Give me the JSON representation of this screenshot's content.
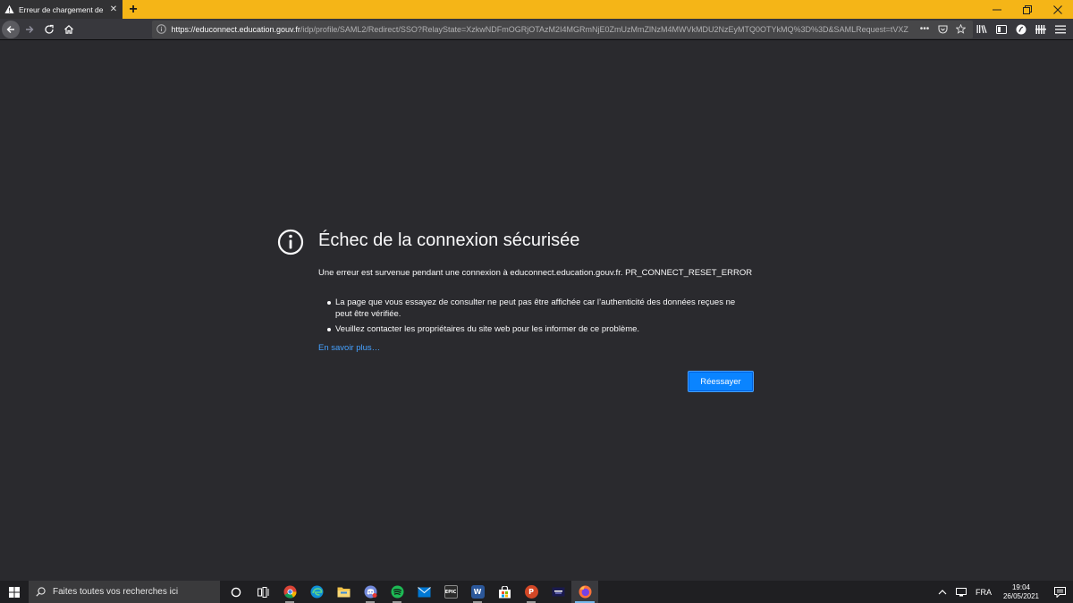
{
  "browser": {
    "tab_title": "Erreur de chargement de la page",
    "url_host": "https://educonnect.education.gouv.fr",
    "url_path": "/idp/profile/SAML2/Redirect/SSO?RelayState=XzkwNDFmOGRjOTAzM2I4MGRmNjE0ZmUzMmZlNzM4MWVkMDU2NzEyMTQ0OTYkMQ%3D%3D&SAMLRequest=tVXZ",
    "page_actions": "•••"
  },
  "error_page": {
    "title": "Échec de la connexion sécurisée",
    "description": "Une erreur est survenue pendant une connexion à educonnect.education.gouv.fr. PR_CONNECT_RESET_ERROR",
    "bullets": [
      "La page que vous essayez de consulter ne peut pas être affichée car l’authenticité des données reçues ne peut être vérifiée.",
      "Veuillez contacter les propriétaires du site web pour les informer de ce problème."
    ],
    "learn_more": "En savoir plus…",
    "retry_label": "Réessayer"
  },
  "taskbar": {
    "search_placeholder": "Faites toutes vos recherches ici",
    "apps": [
      {
        "name": "chrome-icon",
        "label": "",
        "color": "#db4437"
      },
      {
        "name": "edge-icon",
        "label": "",
        "color": "#0f8fd6"
      },
      {
        "name": "file-explorer-icon",
        "label": "",
        "color": "#f2c34a"
      },
      {
        "name": "discord-icon",
        "label": "",
        "color": "#7289da"
      },
      {
        "name": "spotify-icon",
        "label": "",
        "color": "#1db954"
      },
      {
        "name": "mail-icon",
        "label": "",
        "color": "#0078d4"
      },
      {
        "name": "epic-games-icon",
        "label": "EPIC",
        "color": "#2b2b2b"
      },
      {
        "name": "word-icon",
        "label": "W",
        "color": "#2b579a"
      },
      {
        "name": "store-icon",
        "label": "",
        "color": "#ffffff"
      },
      {
        "name": "powerpoint-icon",
        "label": "P",
        "color": "#d24726"
      },
      {
        "name": "app-icon",
        "label": "",
        "color": "#1a1a4e"
      },
      {
        "name": "firefox-icon",
        "label": "",
        "color": "#ff7139"
      }
    ],
    "language": "FRA",
    "time": "19:04",
    "date": "26/05/2021"
  },
  "colors": {
    "accent_tab_strip": "#f5b517",
    "link": "#45a1ff",
    "primary_button": "#0a84ff",
    "page_background": "#2a2a2e"
  }
}
